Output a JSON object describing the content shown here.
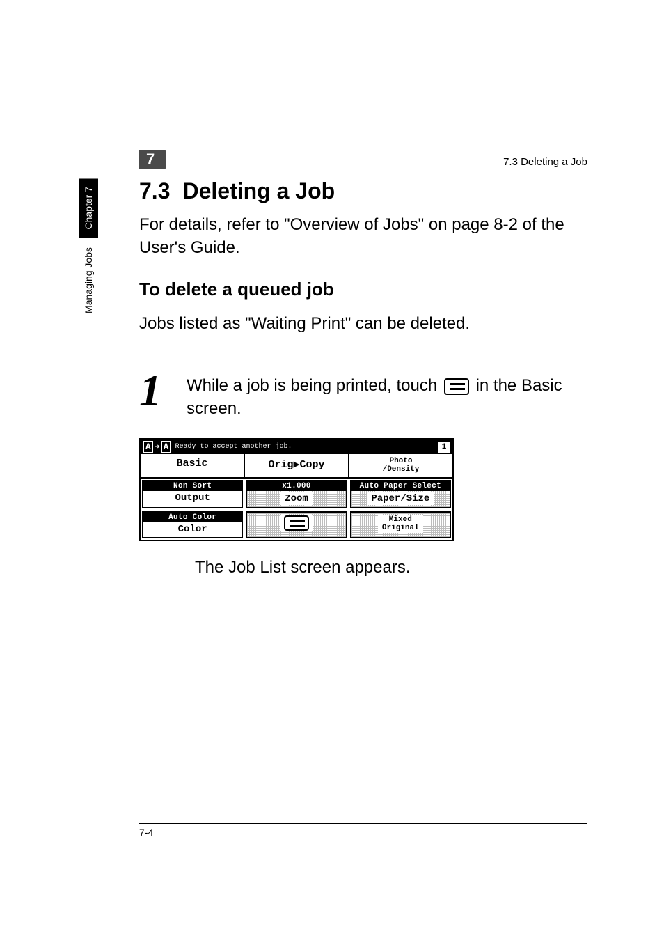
{
  "sidebar": {
    "chapter_label": "Chapter 7",
    "section_label": "Managing Jobs"
  },
  "header": {
    "chapter_num": "7",
    "running_head": "7.3 Deleting a Job"
  },
  "section": {
    "number": "7.3",
    "title": "Deleting a Job",
    "intro": "For details, refer to \"Overview of Jobs\" on page 8-2 of the User's Guide.",
    "subheading": "To delete a queued job",
    "subintro": "Jobs listed as \"Waiting Print\" can be deleted."
  },
  "step1": {
    "num": "1",
    "text_before_icon": "While a job is being printed, touch ",
    "text_after_icon": " in the Basic screen.",
    "result": "The Job List screen appears."
  },
  "screen": {
    "status_aa_left": "A",
    "status_aa_right": "A",
    "status_msg": "Ready to accept another job.",
    "status_badge": "1",
    "tabs": {
      "basic": "Basic",
      "origcopy": "Orig▶Copy",
      "photo_line1": "Photo",
      "photo_line2": "/Density"
    },
    "row1": {
      "output_top": "Non Sort",
      "output_label": "Output",
      "zoom_value": "x1.000",
      "zoom_label": "Zoom",
      "paper_top": "Auto Paper Select",
      "paper_label": "Paper/Size"
    },
    "row2": {
      "color_top": "Auto Color",
      "color_label": "Color",
      "mixed_line1": "Mixed",
      "mixed_line2": "Original"
    }
  },
  "footer": {
    "page_num": "7-4"
  }
}
